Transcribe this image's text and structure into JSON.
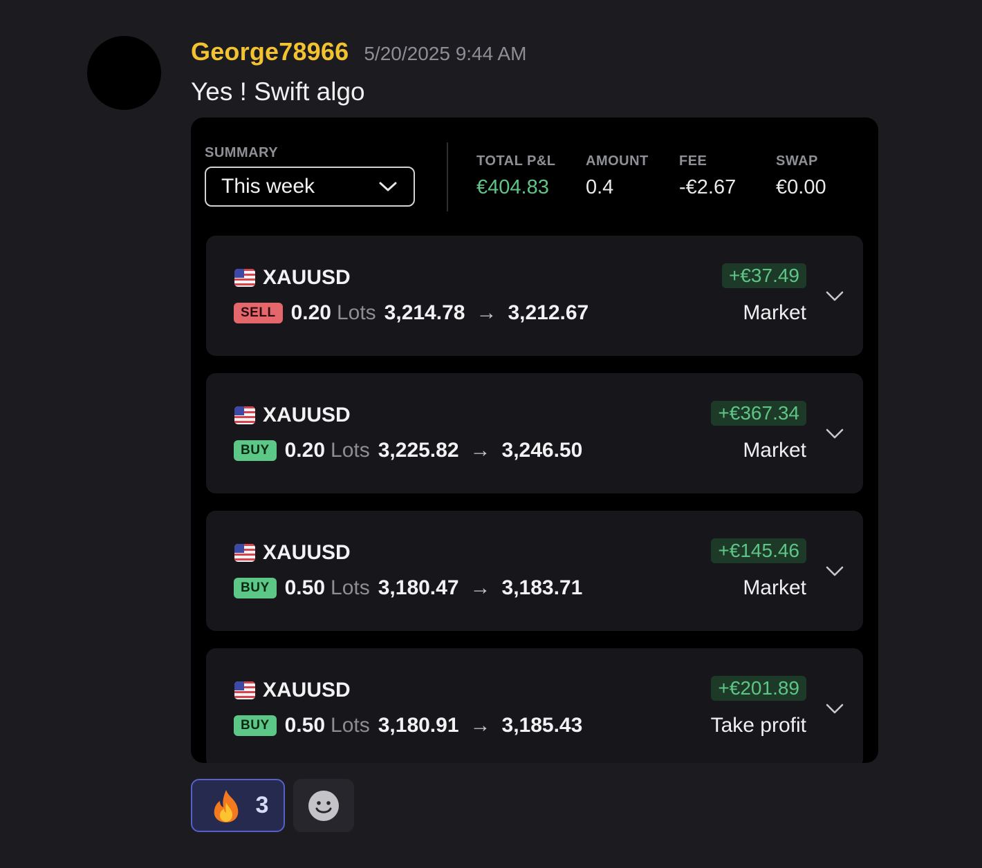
{
  "message": {
    "username": "George78966",
    "timestamp": "5/20/2025 9:44 AM",
    "text": "Yes ! Swift algo",
    "username_color": "#f2c230"
  },
  "summary": {
    "label": "SUMMARY",
    "period": "This week",
    "stats": [
      {
        "label": "TOTAL P&L",
        "value": "€404.83"
      },
      {
        "label": "AMOUNT",
        "value": "0.4"
      },
      {
        "label": "FEE",
        "value": "-€2.67"
      },
      {
        "label": "SWAP",
        "value": "€0.00"
      }
    ]
  },
  "trades": [
    {
      "symbol": "XAUUSD",
      "side": "SELL",
      "lots": "0.20",
      "lots_word": "Lots",
      "open": "3,214.78",
      "close": "3,212.67",
      "pnl": "+€37.49",
      "close_type": "Market"
    },
    {
      "symbol": "XAUUSD",
      "side": "BUY",
      "lots": "0.20",
      "lots_word": "Lots",
      "open": "3,225.82",
      "close": "3,246.50",
      "pnl": "+€367.34",
      "close_type": "Market"
    },
    {
      "symbol": "XAUUSD",
      "side": "BUY",
      "lots": "0.50",
      "lots_word": "Lots",
      "open": "3,180.47",
      "close": "3,183.71",
      "pnl": "+€145.46",
      "close_type": "Market"
    },
    {
      "symbol": "XAUUSD",
      "side": "BUY",
      "lots": "0.50",
      "lots_word": "Lots",
      "open": "3,180.91",
      "close": "3,185.43",
      "pnl": "+€201.89",
      "close_type": "Take profit"
    }
  ],
  "reactions": [
    {
      "emoji": "fire-icon",
      "count": "3"
    }
  ],
  "add_reaction_icon": "smiley-icon",
  "colors": {
    "background": "#1b1b20",
    "profit_green": "#5fc587",
    "sell_red": "#e4676b",
    "buy_green": "#5cc786",
    "reaction_accent": "#5561c9"
  }
}
